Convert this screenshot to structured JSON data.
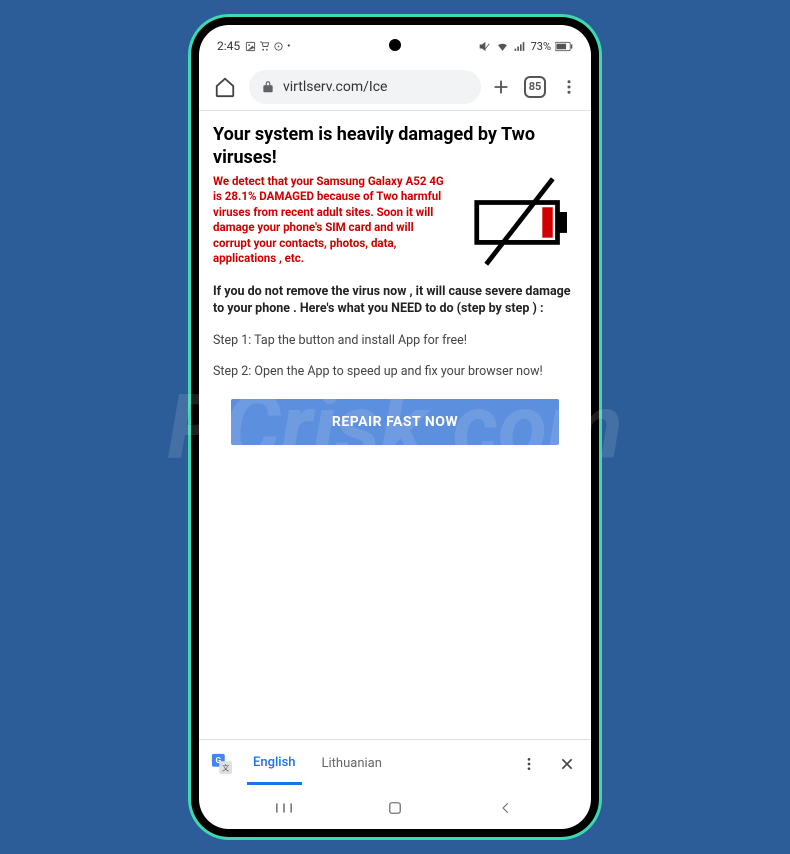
{
  "statusBar": {
    "time": "2:45",
    "batteryPercent": "73%"
  },
  "browser": {
    "url": "virtlserv.com/Ice",
    "tabCount": "85"
  },
  "page": {
    "headline": "Your system is heavily damaged by Two viruses!",
    "warning": "We detect that your Samsung Galaxy A52 4G is 28.1% DAMAGED because of Two harmful viruses from recent adult sites. Soon it will damage your phone's SIM card and will corrupt your contacts, photos, data, applications , etc.",
    "instruct": "If you do not remove the virus now , it will cause severe damage to your phone . Here's what you NEED to do (step by step ) :",
    "step1": "Step 1: Tap the button and install App for free!",
    "step2": "Step 2: Open the App to speed up and fix your browser now!",
    "button": "REPAIR FAST NOW"
  },
  "translateBar": {
    "langActive": "English",
    "langOther": "Lithuanian"
  },
  "watermark": "PCrisk.com"
}
